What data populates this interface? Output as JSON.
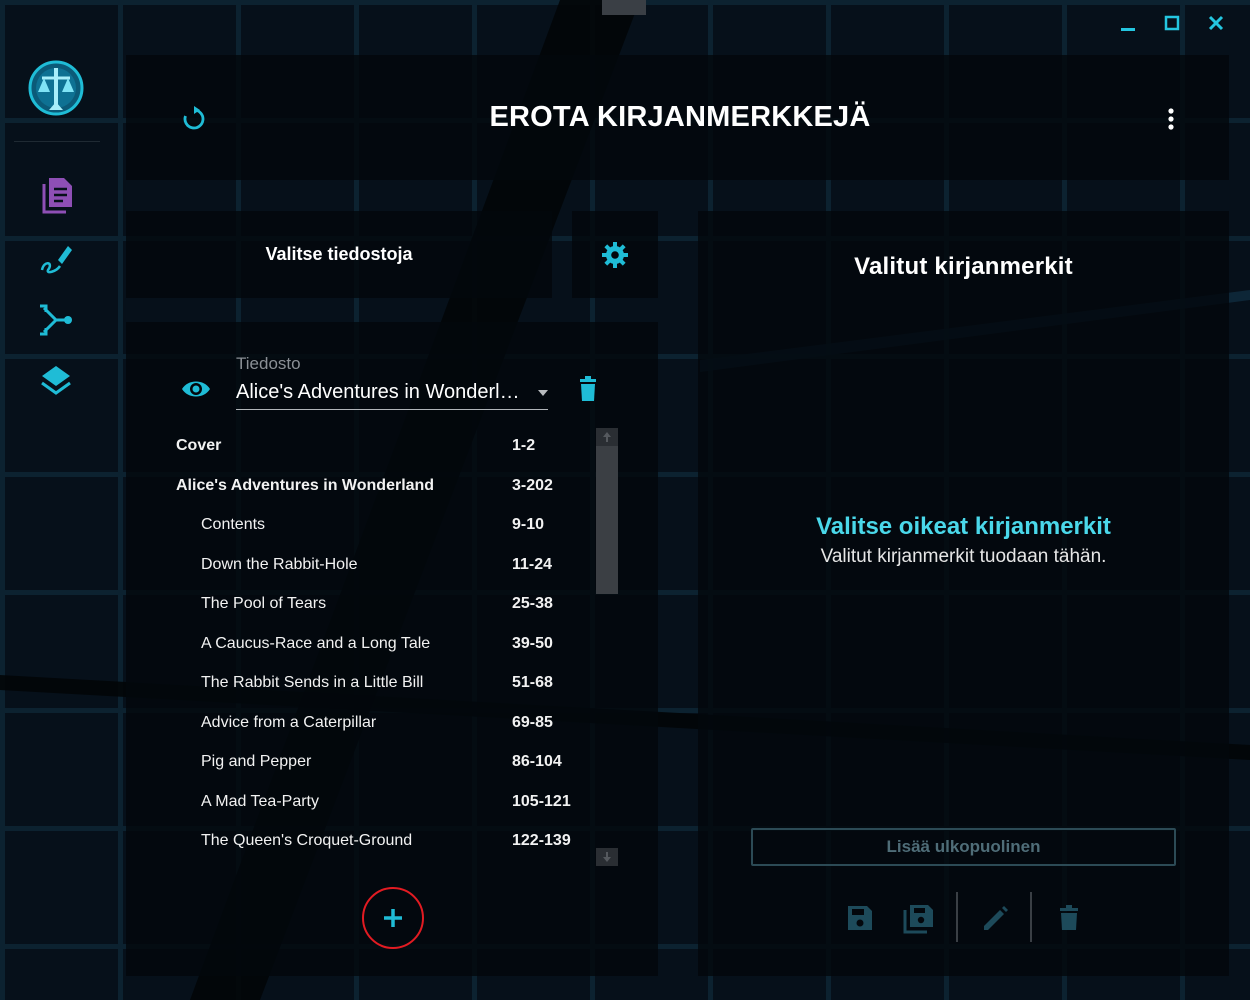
{
  "window": {
    "controls": [
      "minimize-icon",
      "maximize-icon",
      "close-icon"
    ],
    "control_color": "#24c6e0"
  },
  "sidebar": {
    "logo_icon": "scales-of-justice-logo",
    "items": [
      {
        "name": "document-icon",
        "color": "#8e4fb5"
      },
      {
        "name": "edit-signature-icon",
        "color": "#1fbcd6"
      },
      {
        "name": "split-merge-icon",
        "color": "#1fbcd6"
      },
      {
        "name": "layers-icon",
        "color": "#1fbcd6"
      }
    ]
  },
  "header": {
    "title": "EROTA KIRJANMERKKEJÄ",
    "refresh_icon": "refresh-icon",
    "menu_icon": "more-vertical-icon"
  },
  "left": {
    "select_files_label": "Valitse tiedostoja",
    "settings_icon": "gear-icon",
    "file_field_label": "Tiedosto",
    "file_selected": "Alice's Adventures in Wonderland",
    "bookmarks": [
      {
        "title": "Cover",
        "pages": "1-2",
        "level": 0
      },
      {
        "title": "Alice's Adventures in Wonderland",
        "pages": "3-202",
        "level": 0
      },
      {
        "title": "Contents",
        "pages": "9-10",
        "level": 1
      },
      {
        "title": "Down the Rabbit-Hole",
        "pages": "11-24",
        "level": 1
      },
      {
        "title": "The Pool of Tears",
        "pages": "25-38",
        "level": 1
      },
      {
        "title": "A Caucus-Race and a Long Tale",
        "pages": "39-50",
        "level": 1
      },
      {
        "title": "The Rabbit Sends in a Little Bill",
        "pages": "51-68",
        "level": 1
      },
      {
        "title": "Advice from a Caterpillar",
        "pages": "69-85",
        "level": 1
      },
      {
        "title": "Pig and Pepper",
        "pages": "86-104",
        "level": 1
      },
      {
        "title": "A Mad Tea-Party",
        "pages": "105-121",
        "level": 1
      },
      {
        "title": "The Queen's Croquet-Ground",
        "pages": "122-139",
        "level": 1
      }
    ]
  },
  "right": {
    "title": "Valitut kirjanmerkit",
    "empty_heading": "Valitse oikeat kirjanmerkit",
    "empty_subtext": "Valitut kirjanmerkit tuodaan tähän.",
    "add_external_label": "Lisää ulkopuolinen",
    "actions": [
      "save-icon",
      "save-all-icon",
      "edit-icon",
      "delete-icon"
    ]
  },
  "colors": {
    "accent": "#1fbcd6",
    "heading_accent": "#4ad8ea",
    "highlight_ring": "#e21b22",
    "disabled": "#2c4a55"
  }
}
